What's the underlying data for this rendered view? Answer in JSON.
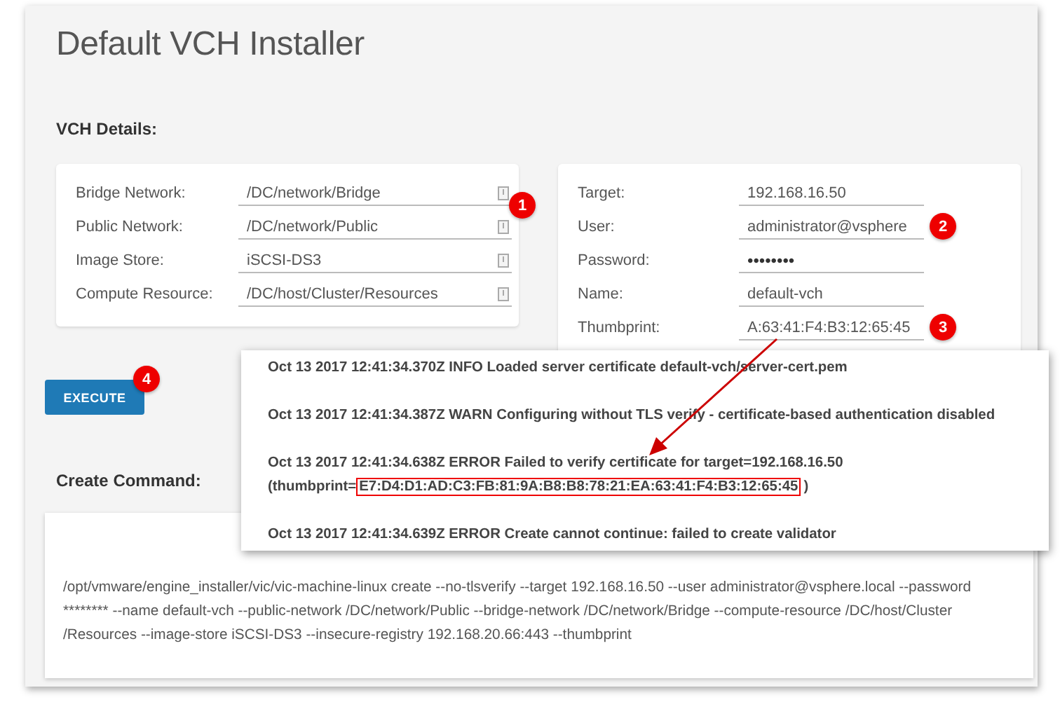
{
  "title": "Default VCH Installer",
  "details_heading": "VCH Details:",
  "left_card": {
    "badge": "1",
    "fields": [
      {
        "label": "Bridge Network:",
        "value": "/DC/network/Bridge"
      },
      {
        "label": "Public Network:",
        "value": "/DC/network/Public"
      },
      {
        "label": "Image Store:",
        "value": "iSCSI-DS3"
      },
      {
        "label": "Compute Resource:",
        "value": "/DC/host/Cluster/Resources"
      }
    ]
  },
  "right_card": {
    "fields": [
      {
        "label": "Target:",
        "value": "192.168.16.50"
      },
      {
        "label": "User:",
        "value": "administrator@vsphere",
        "badge": "2"
      },
      {
        "label": "Password:",
        "value": "••••••••",
        "kind": "password"
      },
      {
        "label": "Name:",
        "value": "default-vch"
      },
      {
        "label": "Thumbprint:",
        "value": "A:63:41:F4:B3:12:65:45",
        "badge": "3"
      }
    ]
  },
  "execute": {
    "label": "EXECUTE",
    "badge": "4"
  },
  "command_heading": "Create Command:",
  "command": "/opt/vmware/engine_installer/vic/vic-machine-linux create --no-tlsverify --target 192.168.16.50 --user administrator@vsphere.local --password ******** --name default-vch --public-network /DC/network/Public --bridge-network /DC/network/Bridge --compute-resource /DC/host/Cluster /Resources --image-store iSCSI-DS3 --insecure-registry 192.168.20.66:443 --thumbprint",
  "log": [
    {
      "kind": "plain",
      "text": "Oct 13 2017 12:41:34.370Z INFO  Loaded server certificate default-vch/server-cert.pem"
    },
    {
      "kind": "plain",
      "text": "Oct 13 2017 12:41:34.387Z WARN  Configuring without TLS verify - certificate-based authentication disabled"
    },
    {
      "kind": "plain",
      "text": "Oct 13 2017 12:41:34.638Z ERROR Failed to verify certificate for target=192.168.16.50"
    },
    {
      "kind": "highlight",
      "prefix": "(thumbprint=",
      "highlight": "E7:D4:D1:AD:C3:FB:81:9A:B8:B8:78:21:EA:63:41:F4:B3:12:65:45",
      "suffix": ")"
    },
    {
      "kind": "plain",
      "text": "Oct 13 2017 12:41:34.639Z ERROR Create cannot continue: failed to create validator"
    }
  ]
}
